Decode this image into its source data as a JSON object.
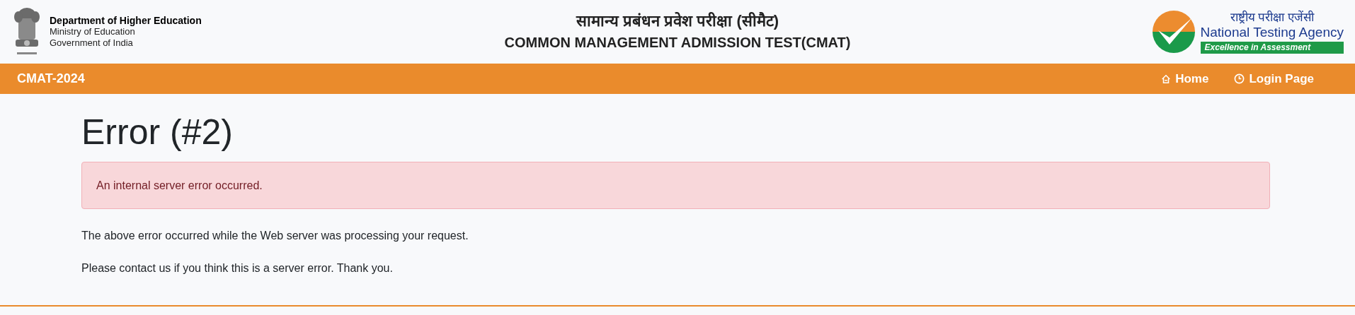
{
  "header": {
    "department": {
      "name": "Department of Higher Education",
      "lines": [
        "Ministry of Education",
        "Government of India"
      ]
    },
    "title_hindi": "सामान्य प्रबंधन प्रवेश परीक्षा (सीमैट)",
    "title": "COMMON MANAGEMENT ADMISSION TEST(CMAT)",
    "agency": {
      "name_hindi": "राष्ट्रीय परीक्षा एजेंसी",
      "name": "National Testing Agency",
      "tagline": "Excellence in Assessment"
    }
  },
  "navbar": {
    "brand": "CMAT-2024",
    "links": [
      {
        "kind": "home",
        "label": "Home"
      },
      {
        "kind": "clock",
        "label": "Login Page"
      }
    ]
  },
  "content": {
    "heading": "Error (#2)",
    "alert": "An internal server error occurred.",
    "paragraphs": [
      "The above error occurred while the Web server was processing your request.",
      "Please contact us if you think this is a server error. Thank you."
    ]
  }
}
